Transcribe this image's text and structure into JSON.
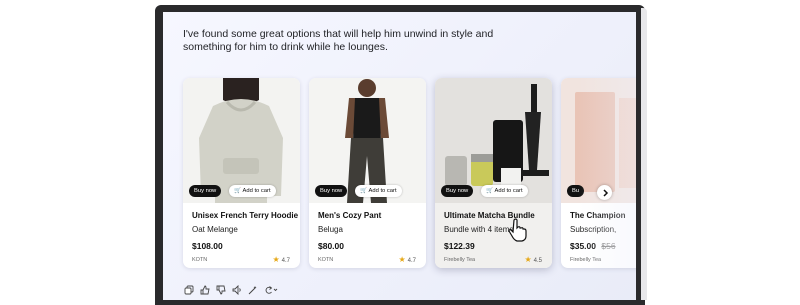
{
  "message": "I've found some great options that will help him unwind in style and something for him to drink while he lounges.",
  "products": [
    {
      "title": "Unisex French Terry Hoodie",
      "subtitle": "Oat Melange",
      "price": "$108.00",
      "vendor": "KOTN",
      "rating": "4.7",
      "buy_label": "Buy now",
      "cart_label": "Add to cart"
    },
    {
      "title": "Men's Cozy Pant",
      "subtitle": "Beluga",
      "price": "$80.00",
      "vendor": "KOTN",
      "rating": "4.7",
      "buy_label": "Buy now",
      "cart_label": "Add to cart"
    },
    {
      "title": "Ultimate Matcha Bundle",
      "subtitle": "Bundle with 4 items",
      "price": "$122.39",
      "vendor": "Firebelly Tea",
      "rating": "4.5",
      "buy_label": "Buy now",
      "cart_label": "Add to cart"
    },
    {
      "title": "The Champion",
      "subtitle": "Subscription,",
      "price": "$35.00",
      "old_price": "$56",
      "vendor": "Firebelly Tea",
      "buy_label": "Bu"
    }
  ],
  "icons": {
    "next": "chevron-right-icon",
    "copy": "copy-icon",
    "like": "thumbs-up-icon",
    "dislike": "thumbs-down-icon",
    "speak": "speaker-icon",
    "edit": "magic-edit-icon",
    "regenerate": "refresh-icon",
    "star": "star-icon"
  },
  "colors": {
    "accent_dark": "#111111",
    "star": "#e6a817",
    "screen_bg": "#eef0fb"
  }
}
